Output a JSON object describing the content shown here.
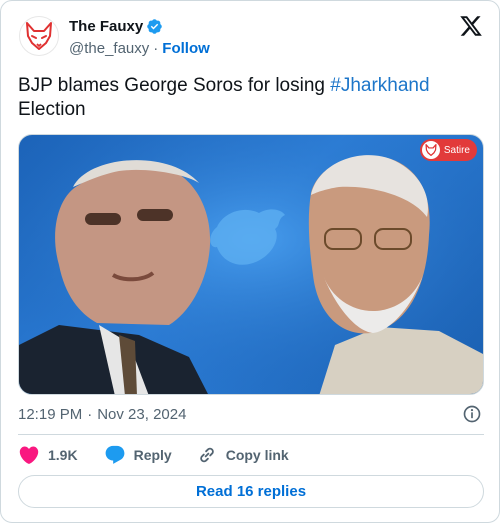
{
  "author": {
    "name": "The Fauxy",
    "handle": "@the_fauxy",
    "follow_label": "Follow"
  },
  "tweet": {
    "text_before": "BJP blames George Soros for losing ",
    "hashtag": "#Jharkhand",
    "text_after": " Election"
  },
  "media": {
    "badge_label": "Satire"
  },
  "meta": {
    "time": "12:19 PM",
    "separator": "·",
    "date": "Nov 23, 2024"
  },
  "actions": {
    "likes_count": "1.9K",
    "reply_label": "Reply",
    "copy_link_label": "Copy link"
  },
  "read_replies_label": "Read 16 replies",
  "colors": {
    "link_blue": "#006fd6",
    "like_pink": "#f91880",
    "verified_blue": "#1d9bf0",
    "media_blue": "#2d7fd9",
    "satire_red": "#e23a3a"
  }
}
